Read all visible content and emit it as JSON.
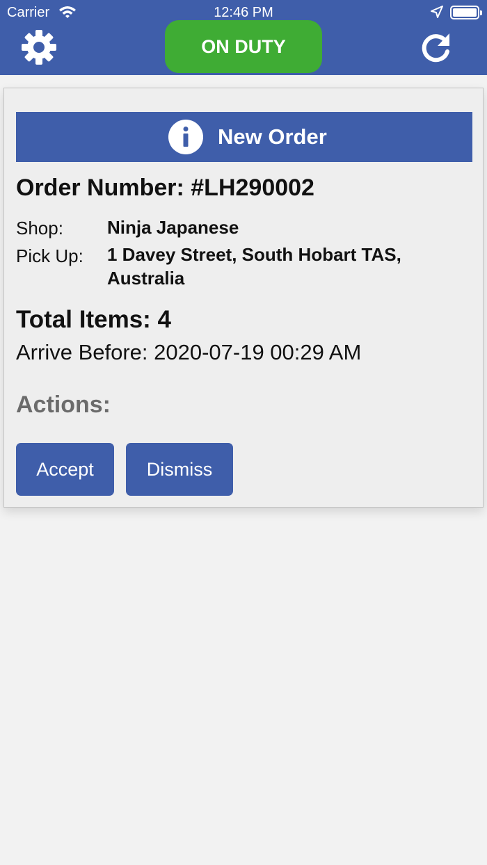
{
  "status_bar": {
    "carrier": "Carrier",
    "time": "12:46 PM",
    "wifi_icon": "wifi-icon",
    "location_icon": "location-arrow-icon",
    "battery_level": 1.0
  },
  "header": {
    "settings_icon": "gear-icon",
    "duty_label": "ON DUTY",
    "duty_color": "#3fac34",
    "refresh_icon": "refresh-icon",
    "background_color": "#3f5eaa"
  },
  "order_card": {
    "banner_title": "New Order",
    "banner_icon": "info-icon",
    "order_number": "Order Number: #LH290002",
    "shop_label": "Shop:",
    "shop_value": "Ninja Japanese",
    "pickup_label": "Pick Up:",
    "pickup_value": "1 Davey Street, South Hobart TAS, Australia",
    "total_items": "Total Items: 4",
    "arrive_before": "Arrive Before: 2020-07-19 00:29 AM",
    "actions_label": "Actions:",
    "accept_label": "Accept",
    "dismiss_label": "Dismiss",
    "accent_color": "#3f5eaa"
  }
}
